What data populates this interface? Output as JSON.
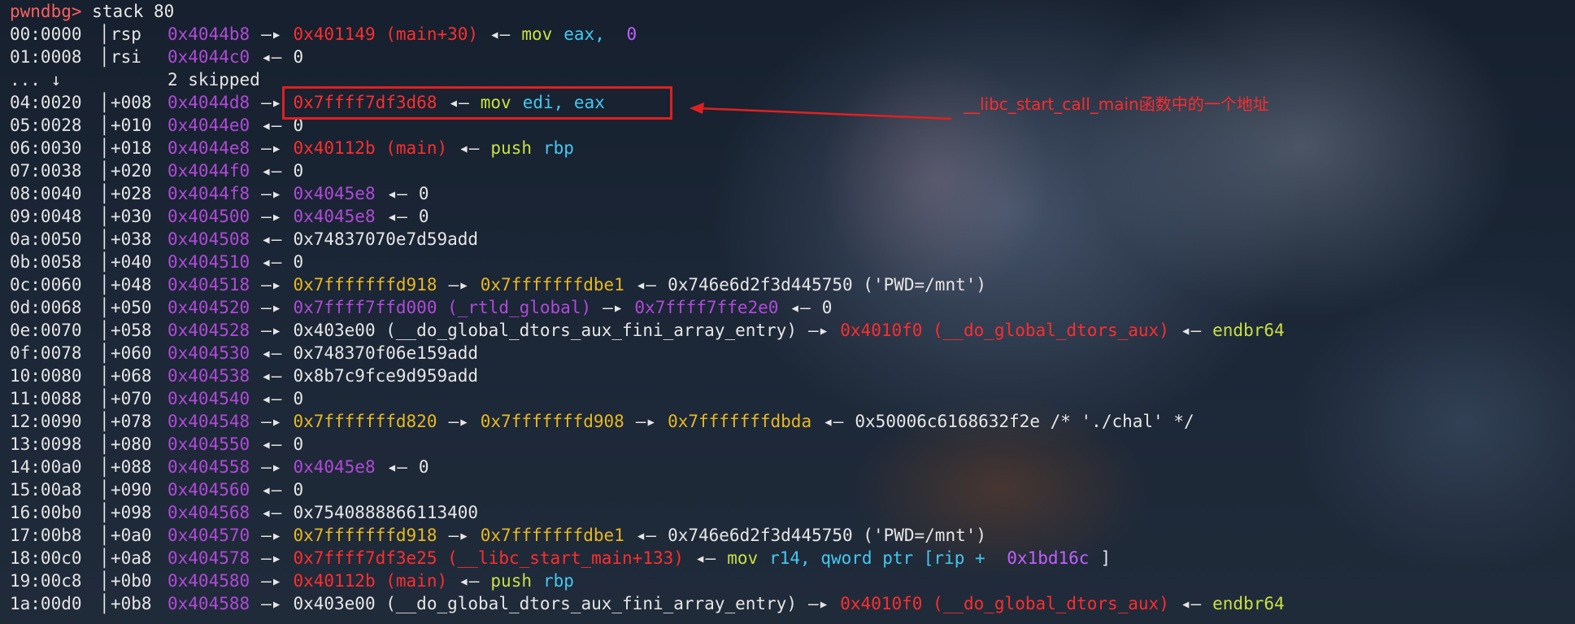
{
  "prompt": "pwndbg>",
  "command": "stack 80",
  "skipped_row": {
    "index": "...",
    "arrow_glyph": "↓",
    "text": "2 skipped"
  },
  "annotation": "__libc_start_call_main函数中的一个地址",
  "colors": {
    "red": "#ff2d2d",
    "magenta": "#b04ad8",
    "yellow": "#e8b820",
    "green": "#c8e043",
    "cyan": "#45c8f0",
    "purple": "#c060ff",
    "white": "#e6e6e6"
  },
  "rows": [
    {
      "index": "00:0000",
      "field": "rsp",
      "addr": "0x4044b8",
      "segs": [
        {
          "t": "—▸",
          "c": "white"
        },
        {
          "t": "0x401149 (main+30)",
          "c": "red"
        },
        {
          "t": "◂—",
          "c": "white"
        },
        {
          "t": "mov",
          "c": "green"
        },
        {
          "t": "eax, ",
          "c": "cyan"
        },
        {
          "t": "0",
          "c": "purple"
        }
      ]
    },
    {
      "index": "01:0008",
      "field": "rsi",
      "addr": "0x4044c0",
      "segs": [
        {
          "t": "◂—",
          "c": "white"
        },
        {
          "t": "0",
          "c": "white"
        }
      ]
    },
    {
      "skipped": true
    },
    {
      "index": "04:0020",
      "field": "+008",
      "addr": "0x4044d8",
      "segs": [
        {
          "t": "—▸",
          "c": "white"
        },
        {
          "t": "0x7ffff7df3d68",
          "c": "red"
        },
        {
          "t": "◂—",
          "c": "white"
        },
        {
          "t": "mov",
          "c": "green"
        },
        {
          "t": "edi, eax",
          "c": "cyan"
        }
      ]
    },
    {
      "index": "05:0028",
      "field": "+010",
      "addr": "0x4044e0",
      "segs": [
        {
          "t": "◂—",
          "c": "white"
        },
        {
          "t": "0",
          "c": "white"
        }
      ]
    },
    {
      "index": "06:0030",
      "field": "+018",
      "addr": "0x4044e8",
      "segs": [
        {
          "t": "—▸",
          "c": "white"
        },
        {
          "t": "0x40112b (main)",
          "c": "red"
        },
        {
          "t": "◂—",
          "c": "white"
        },
        {
          "t": "push",
          "c": "green"
        },
        {
          "t": "rbp",
          "c": "cyan"
        }
      ]
    },
    {
      "index": "07:0038",
      "field": "+020",
      "addr": "0x4044f0",
      "segs": [
        {
          "t": "◂—",
          "c": "white"
        },
        {
          "t": "0",
          "c": "white"
        }
      ]
    },
    {
      "index": "08:0040",
      "field": "+028",
      "addr": "0x4044f8",
      "segs": [
        {
          "t": "—▸",
          "c": "white"
        },
        {
          "t": "0x4045e8",
          "c": "magenta"
        },
        {
          "t": "◂—",
          "c": "white"
        },
        {
          "t": "0",
          "c": "white"
        }
      ]
    },
    {
      "index": "09:0048",
      "field": "+030",
      "addr": "0x404500",
      "segs": [
        {
          "t": "—▸",
          "c": "white"
        },
        {
          "t": "0x4045e8",
          "c": "magenta"
        },
        {
          "t": "◂—",
          "c": "white"
        },
        {
          "t": "0",
          "c": "white"
        }
      ]
    },
    {
      "index": "0a:0050",
      "field": "+038",
      "addr": "0x404508",
      "segs": [
        {
          "t": "◂—",
          "c": "white"
        },
        {
          "t": "0x74837070e7d59add",
          "c": "white"
        }
      ]
    },
    {
      "index": "0b:0058",
      "field": "+040",
      "addr": "0x404510",
      "segs": [
        {
          "t": "◂—",
          "c": "white"
        },
        {
          "t": "0",
          "c": "white"
        }
      ]
    },
    {
      "index": "0c:0060",
      "field": "+048",
      "addr": "0x404518",
      "segs": [
        {
          "t": "—▸",
          "c": "white"
        },
        {
          "t": "0x7fffffffd918",
          "c": "yellow"
        },
        {
          "t": "—▸",
          "c": "white"
        },
        {
          "t": "0x7fffffffdbe1",
          "c": "yellow"
        },
        {
          "t": "◂—",
          "c": "white"
        },
        {
          "t": "0x746e6d2f3d445750 ('PWD=/mnt')",
          "c": "white"
        }
      ]
    },
    {
      "index": "0d:0068",
      "field": "+050",
      "addr": "0x404520",
      "segs": [
        {
          "t": "—▸",
          "c": "white"
        },
        {
          "t": "0x7ffff7ffd000 (_rtld_global)",
          "c": "magenta"
        },
        {
          "t": "—▸",
          "c": "white"
        },
        {
          "t": "0x7ffff7ffe2e0",
          "c": "magenta"
        },
        {
          "t": "◂—",
          "c": "white"
        },
        {
          "t": "0",
          "c": "white"
        }
      ]
    },
    {
      "index": "0e:0070",
      "field": "+058",
      "addr": "0x404528",
      "segs": [
        {
          "t": "—▸",
          "c": "white"
        },
        {
          "t": "0x403e00 (__do_global_dtors_aux_fini_array_entry)",
          "c": "white"
        },
        {
          "t": "—▸",
          "c": "white"
        },
        {
          "t": "0x4010f0 (__do_global_dtors_aux)",
          "c": "red"
        },
        {
          "t": "◂—",
          "c": "white"
        },
        {
          "t": "endbr64",
          "c": "green"
        }
      ]
    },
    {
      "index": "0f:0078",
      "field": "+060",
      "addr": "0x404530",
      "segs": [
        {
          "t": "◂—",
          "c": "white"
        },
        {
          "t": "0x748370f06e159add",
          "c": "white"
        }
      ]
    },
    {
      "index": "10:0080",
      "field": "+068",
      "addr": "0x404538",
      "segs": [
        {
          "t": "◂—",
          "c": "white"
        },
        {
          "t": "0x8b7c9fce9d959add",
          "c": "white"
        }
      ]
    },
    {
      "index": "11:0088",
      "field": "+070",
      "addr": "0x404540",
      "segs": [
        {
          "t": "◂—",
          "c": "white"
        },
        {
          "t": "0",
          "c": "white"
        }
      ]
    },
    {
      "index": "12:0090",
      "field": "+078",
      "addr": "0x404548",
      "segs": [
        {
          "t": "—▸",
          "c": "white"
        },
        {
          "t": "0x7fffffffd820",
          "c": "yellow"
        },
        {
          "t": "—▸",
          "c": "white"
        },
        {
          "t": "0x7fffffffd908",
          "c": "yellow"
        },
        {
          "t": "—▸",
          "c": "white"
        },
        {
          "t": "0x7fffffffdbda",
          "c": "yellow"
        },
        {
          "t": "◂—",
          "c": "white"
        },
        {
          "t": "0x50006c6168632f2e /* './chal' */",
          "c": "white"
        }
      ]
    },
    {
      "index": "13:0098",
      "field": "+080",
      "addr": "0x404550",
      "segs": [
        {
          "t": "◂—",
          "c": "white"
        },
        {
          "t": "0",
          "c": "white"
        }
      ]
    },
    {
      "index": "14:00a0",
      "field": "+088",
      "addr": "0x404558",
      "segs": [
        {
          "t": "—▸",
          "c": "white"
        },
        {
          "t": "0x4045e8",
          "c": "magenta"
        },
        {
          "t": "◂—",
          "c": "white"
        },
        {
          "t": "0",
          "c": "white"
        }
      ]
    },
    {
      "index": "15:00a8",
      "field": "+090",
      "addr": "0x404560",
      "segs": [
        {
          "t": "◂—",
          "c": "white"
        },
        {
          "t": "0",
          "c": "white"
        }
      ]
    },
    {
      "index": "16:00b0",
      "field": "+098",
      "addr": "0x404568",
      "segs": [
        {
          "t": "◂—",
          "c": "white"
        },
        {
          "t": "0x7540888866113400",
          "c": "white"
        }
      ]
    },
    {
      "index": "17:00b8",
      "field": "+0a0",
      "addr": "0x404570",
      "segs": [
        {
          "t": "—▸",
          "c": "white"
        },
        {
          "t": "0x7fffffffd918",
          "c": "yellow"
        },
        {
          "t": "—▸",
          "c": "white"
        },
        {
          "t": "0x7fffffffdbe1",
          "c": "yellow"
        },
        {
          "t": "◂—",
          "c": "white"
        },
        {
          "t": "0x746e6d2f3d445750 ('PWD=/mnt')",
          "c": "white"
        }
      ]
    },
    {
      "index": "18:00c0",
      "field": "+0a8",
      "addr": "0x404578",
      "segs": [
        {
          "t": "—▸",
          "c": "white"
        },
        {
          "t": "0x7ffff7df3e25 (__libc_start_main+133)",
          "c": "red"
        },
        {
          "t": "◂—",
          "c": "white"
        },
        {
          "t": "mov",
          "c": "green"
        },
        {
          "t": "r14, qword ptr [rip + ",
          "c": "cyan"
        },
        {
          "t": "0x1bd16c",
          "c": "purple"
        },
        {
          "t": "]",
          "c": "white"
        }
      ]
    },
    {
      "index": "19:00c8",
      "field": "+0b0",
      "addr": "0x404580",
      "segs": [
        {
          "t": "—▸",
          "c": "white"
        },
        {
          "t": "0x40112b (main)",
          "c": "red"
        },
        {
          "t": "◂—",
          "c": "white"
        },
        {
          "t": "push",
          "c": "green"
        },
        {
          "t": "rbp",
          "c": "cyan"
        }
      ]
    },
    {
      "index": "1a:00d0",
      "field": "+0b8",
      "addr": "0x404588",
      "segs": [
        {
          "t": "—▸",
          "c": "white"
        },
        {
          "t": "0x403e00 (__do_global_dtors_aux_fini_array_entry)",
          "c": "white"
        },
        {
          "t": "—▸",
          "c": "white"
        },
        {
          "t": "0x4010f0 (__do_global_dtors_aux)",
          "c": "red"
        },
        {
          "t": "◂—",
          "c": "white"
        },
        {
          "t": "endbr64",
          "c": "green"
        }
      ]
    }
  ]
}
